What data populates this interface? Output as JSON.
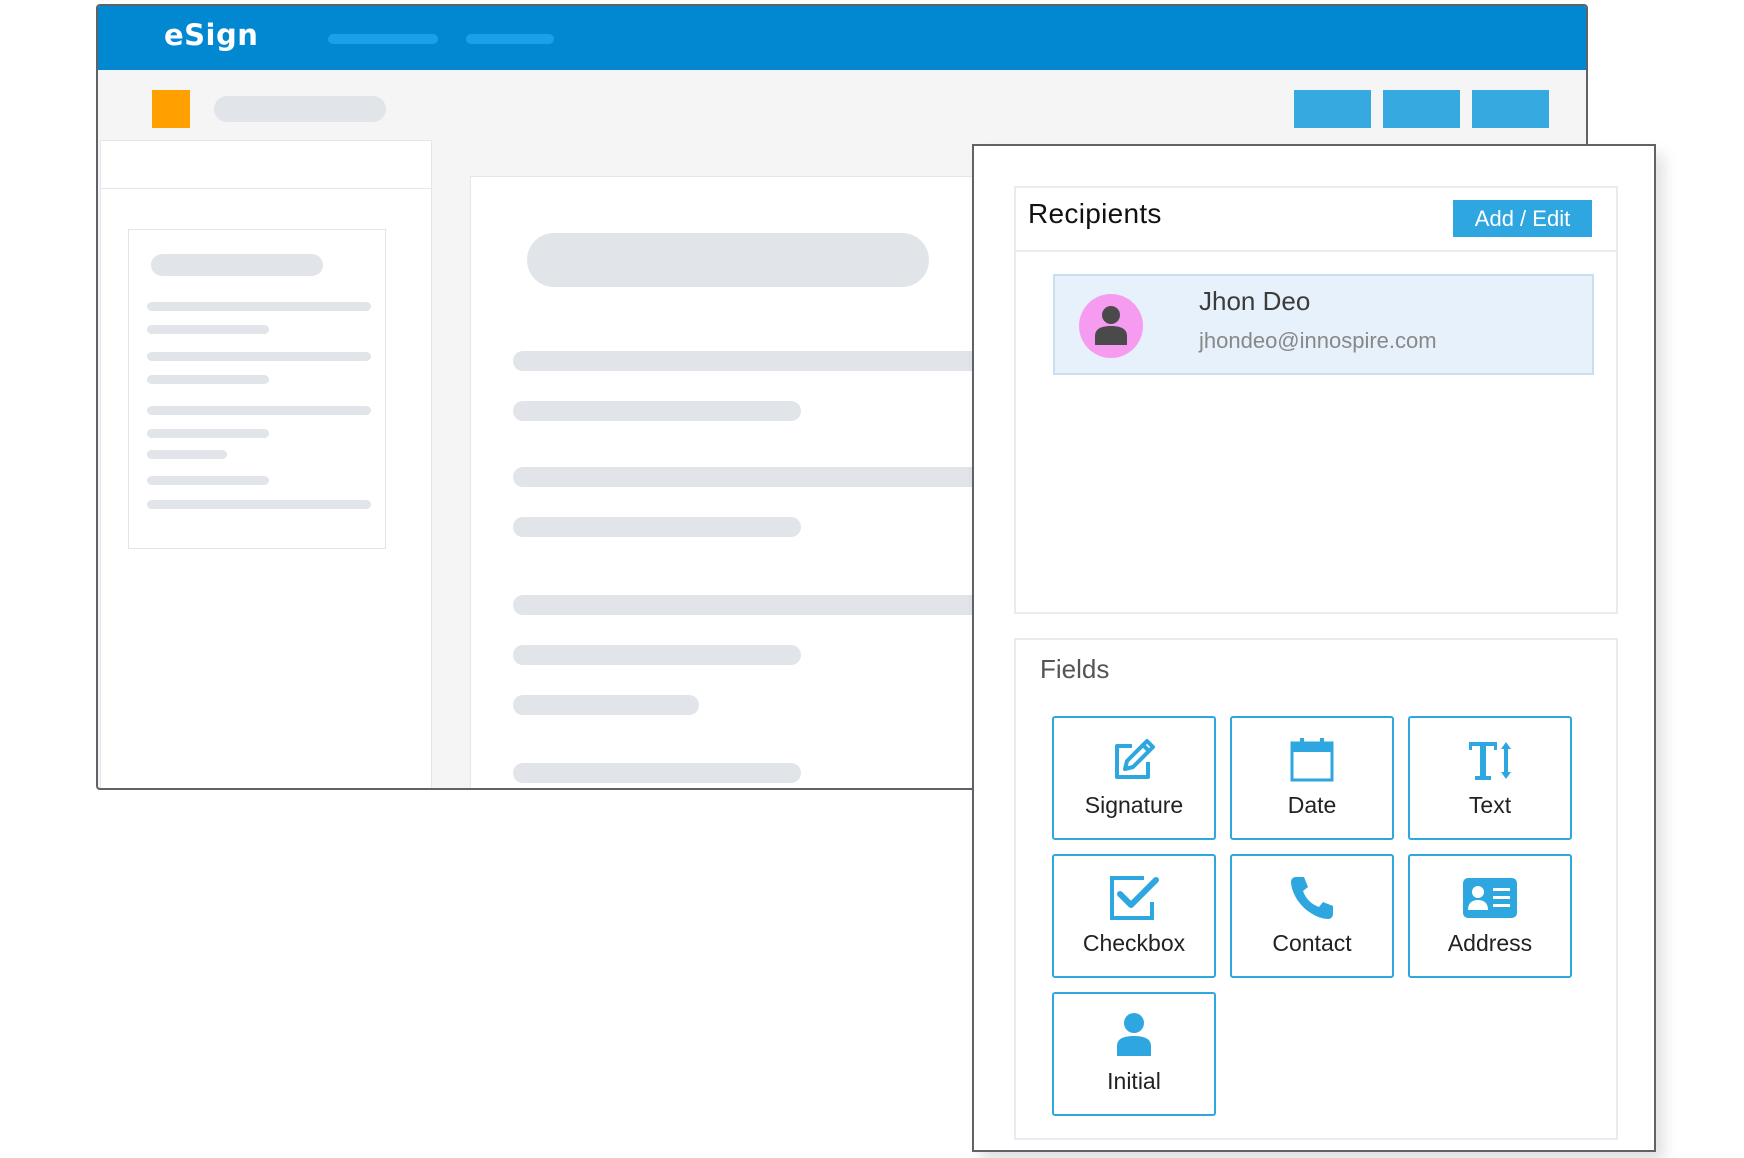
{
  "app": {
    "title": "eSign"
  },
  "recipients": {
    "title": "Recipients",
    "add_edit_label": "Add / Edit",
    "items": [
      {
        "name": "Jhon Deo",
        "email": "jhondeo@innospire.com"
      }
    ]
  },
  "fields": {
    "title": "Fields",
    "items": [
      {
        "label": "Signature",
        "icon": "signature-icon"
      },
      {
        "label": "Date",
        "icon": "calendar-icon"
      },
      {
        "label": "Text",
        "icon": "text-icon"
      },
      {
        "label": "Checkbox",
        "icon": "checkbox-icon"
      },
      {
        "label": "Contact",
        "icon": "phone-icon"
      },
      {
        "label": "Address",
        "icon": "address-card-icon"
      },
      {
        "label": "Initial",
        "icon": "user-icon"
      }
    ]
  },
  "colors": {
    "header": "#0288d1",
    "accent": "#2ea7e0",
    "toolbar_square": "#ffa000",
    "avatar": "#f59cf0",
    "recipient_row": "#e6f1fb"
  }
}
